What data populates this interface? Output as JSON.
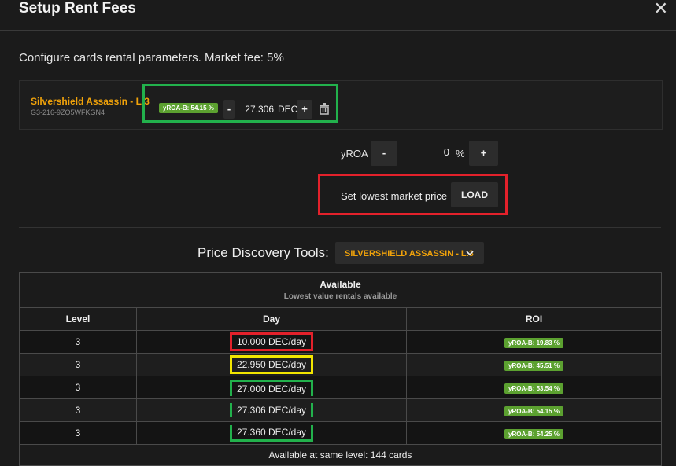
{
  "header": {
    "title": "Setup Rent Fees",
    "close_glyph": "✕"
  },
  "subtitle": "Configure cards rental parameters. Market fee: 5%",
  "card": {
    "name": "Silvershield Assassin - L.3",
    "id": "G3-216-9ZQ5WFKGN4",
    "badge": "yROA-B: 54.15 %",
    "minus": "-",
    "value": "27.306",
    "unit": "DEC",
    "plus": "+"
  },
  "yroa": {
    "label": "yROA",
    "minus": "-",
    "value": "0",
    "pct": "%",
    "plus": "+"
  },
  "lowest": {
    "text": "Set lowest market price",
    "button": "LOAD"
  },
  "pdt": {
    "label": "Price Discovery Tools:",
    "selected": "SILVERSHIELD ASSASSIN - L.3"
  },
  "table": {
    "title": "Available",
    "subtitle": "Lowest value rentals available",
    "columns": [
      "Level",
      "Day",
      "ROI"
    ],
    "rows": [
      {
        "level": "3",
        "day": "10.000 DEC/day",
        "roi": "yROA-B: 19.83 %"
      },
      {
        "level": "3",
        "day": "22.950 DEC/day",
        "roi": "yROA-B: 45.51 %"
      },
      {
        "level": "3",
        "day": "27.000 DEC/day",
        "roi": "yROA-B: 53.54 %"
      },
      {
        "level": "3",
        "day": "27.306 DEC/day",
        "roi": "yROA-B: 54.15 %"
      },
      {
        "level": "3",
        "day": "27.360 DEC/day",
        "roi": "yROA-B: 54.25 %"
      }
    ],
    "footer": "Available at same level: 144 cards"
  },
  "colors": {
    "accent": "#f0a20a",
    "badge": "#5ca130",
    "highlight_green": "#22b14c",
    "highlight_red": "#e3212b",
    "highlight_yellow": "#f2e500"
  }
}
